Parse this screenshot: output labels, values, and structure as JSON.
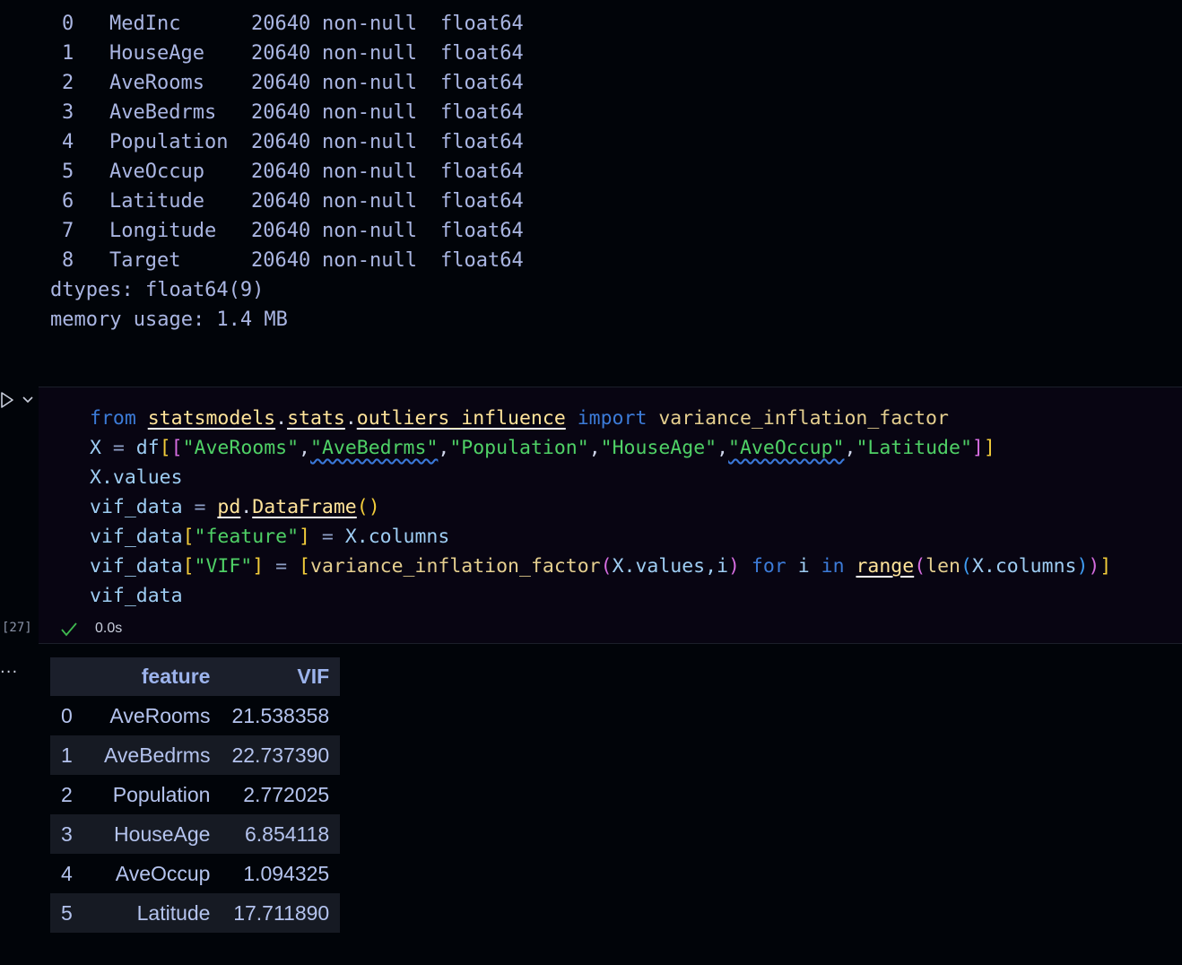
{
  "info_output": {
    "rows": [
      {
        "idx": "0",
        "name": "MedInc",
        "count": "20640",
        "nonnull": "non-null",
        "dtype": "float64"
      },
      {
        "idx": "1",
        "name": "HouseAge",
        "count": "20640",
        "nonnull": "non-null",
        "dtype": "float64"
      },
      {
        "idx": "2",
        "name": "AveRooms",
        "count": "20640",
        "nonnull": "non-null",
        "dtype": "float64"
      },
      {
        "idx": "3",
        "name": "AveBedrms",
        "count": "20640",
        "nonnull": "non-null",
        "dtype": "float64"
      },
      {
        "idx": "4",
        "name": "Population",
        "count": "20640",
        "nonnull": "non-null",
        "dtype": "float64"
      },
      {
        "idx": "5",
        "name": "AveOccup",
        "count": "20640",
        "nonnull": "non-null",
        "dtype": "float64"
      },
      {
        "idx": "6",
        "name": "Latitude",
        "count": "20640",
        "nonnull": "non-null",
        "dtype": "float64"
      },
      {
        "idx": "7",
        "name": "Longitude",
        "count": "20640",
        "nonnull": "non-null",
        "dtype": "float64"
      },
      {
        "idx": "8",
        "name": "Target",
        "count": "20640",
        "nonnull": "non-null",
        "dtype": "float64"
      }
    ],
    "dtypes_line": "dtypes: float64(9)",
    "memory_line": "memory usage: 1.4 MB"
  },
  "cell": {
    "execution_count": "[27]",
    "exec_time": "0.0s",
    "output_menu": "...",
    "code": {
      "l1": {
        "from": "from",
        "m1": "statsmodels",
        "dot1": ".",
        "m2": "stats",
        "dot2": ".",
        "m3": "outliers_influence",
        "import": "import",
        "fn": "variance_inflation_factor"
      },
      "l2": {
        "X": "X",
        "eq": " = ",
        "df": "df",
        "b1": "[",
        "b2": "[",
        "s1": "\"AveRooms\"",
        "s2": "\"AveBedrms\"",
        "s3": "\"Population\"",
        "s4": "\"HouseAge\"",
        "s5": "\"AveOccup\"",
        "s6": "\"Latitude\"",
        "comma": ",",
        "b3": "]",
        "b4": "]"
      },
      "l3": {
        "X": "X",
        "attr": ".values"
      },
      "l4": {
        "v": "vif_data",
        "eq": " = ",
        "pd": "pd",
        "dot": ".",
        "cls": "DataFrame",
        "paren": "()"
      },
      "l5": {
        "v": "vif_data",
        "b1": "[",
        "s": "\"feature\"",
        "b2": "]",
        "eq": " = ",
        "X": "X",
        "attr": ".columns"
      },
      "l6": {
        "v": "vif_data",
        "b1": "[",
        "s": "\"VIF\"",
        "b2": "]",
        "eq": " = ",
        "b3": "[",
        "fn": "variance_inflation_factor",
        "p1": "(",
        "args_X": "X",
        "args_rest": ".values,i",
        "p2": ")",
        "for": "for",
        "i": "i",
        "in": "in",
        "range": "range",
        "p3": "(",
        "len": "len",
        "p4": "(",
        "X2": "X",
        "cols": ".columns",
        "p5": ")",
        "p6": ")",
        "b4": "]"
      },
      "l7": {
        "v": "vif_data"
      }
    }
  },
  "vif_table": {
    "headers": {
      "index": "",
      "feature": "feature",
      "vif": "VIF"
    },
    "rows": [
      {
        "idx": "0",
        "feature": "AveRooms",
        "vif": "21.538358"
      },
      {
        "idx": "1",
        "feature": "AveBedrms",
        "vif": "22.737390"
      },
      {
        "idx": "2",
        "feature": "Population",
        "vif": "2.772025"
      },
      {
        "idx": "3",
        "feature": "HouseAge",
        "vif": "6.854118"
      },
      {
        "idx": "4",
        "feature": "AveOccup",
        "vif": "1.094325"
      },
      {
        "idx": "5",
        "feature": "Latitude",
        "vif": "17.711890"
      }
    ]
  },
  "icons": {
    "run": "run-cell-icon",
    "chevron": "chevron-down-icon",
    "check": "check-icon"
  },
  "colors": {
    "background": "#010409",
    "cell_background": "#080512",
    "success_check": "#3fb950",
    "string": "#4fd166",
    "keyword": "#3c7bd8"
  }
}
